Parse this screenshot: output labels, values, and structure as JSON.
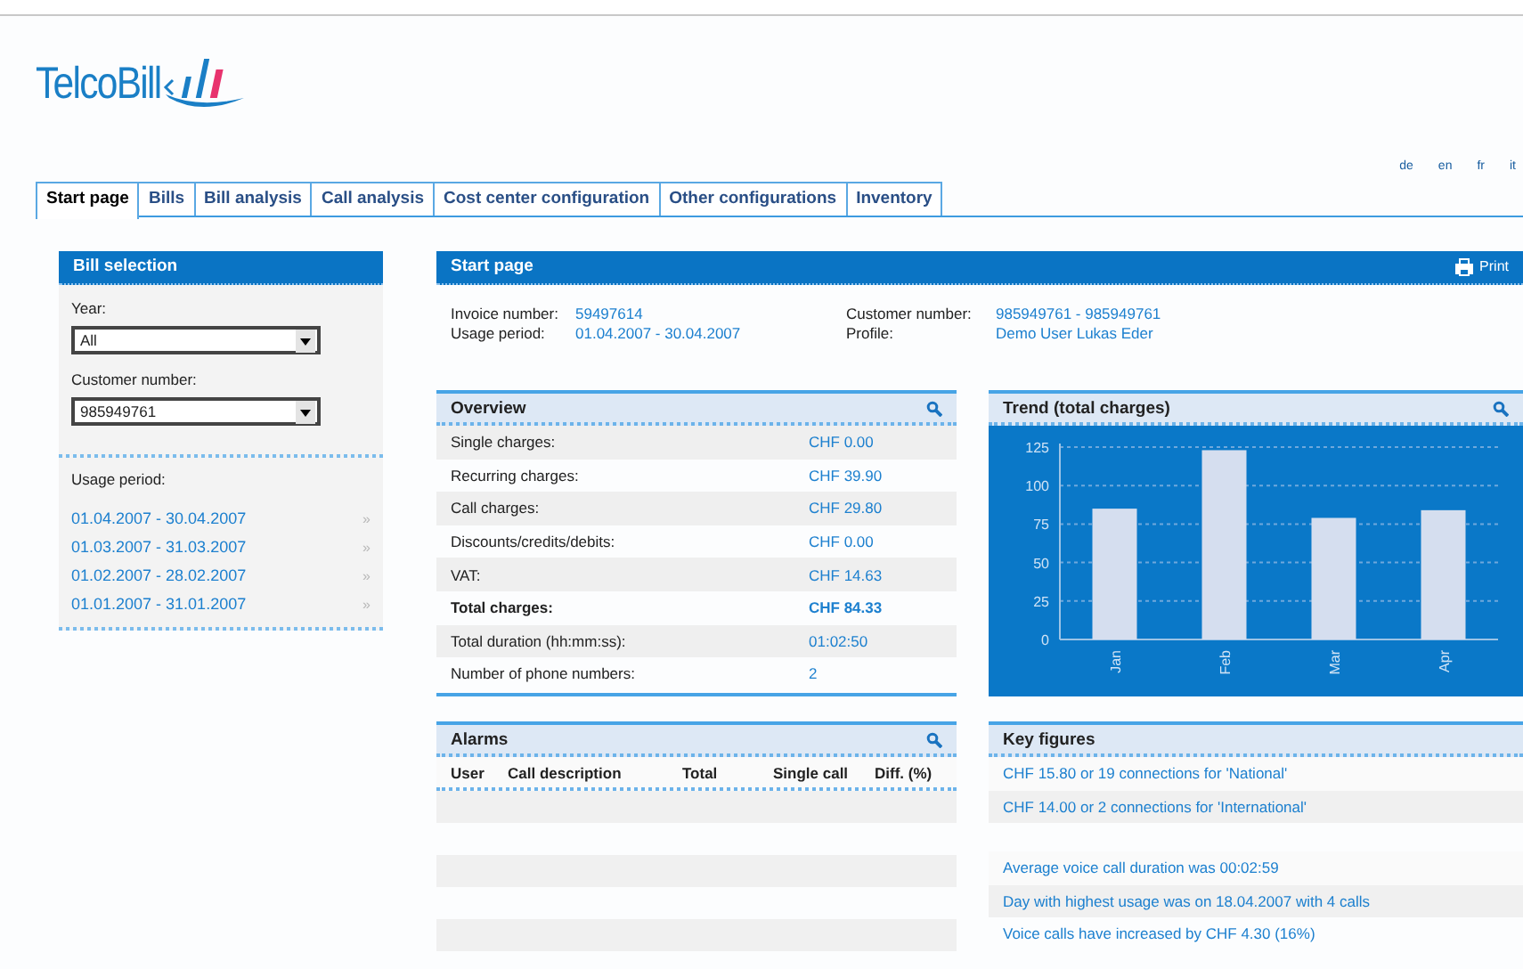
{
  "logo": {
    "text": "TelcoBill"
  },
  "languages": [
    {
      "label": "de"
    },
    {
      "label": "en"
    },
    {
      "label": "fr"
    },
    {
      "label": "it"
    }
  ],
  "tabs": [
    {
      "label": "Start page",
      "selected": true
    },
    {
      "label": "Bills",
      "selected": false
    },
    {
      "label": "Bill analysis",
      "selected": false
    },
    {
      "label": "Call analysis",
      "selected": false
    },
    {
      "label": "Cost center configuration",
      "selected": false
    },
    {
      "label": "Other configurations",
      "selected": false
    },
    {
      "label": "Inventory",
      "selected": false
    }
  ],
  "bill_selection": {
    "title": "Bill selection",
    "fields": [
      {
        "label": "Year:",
        "value": "All"
      },
      {
        "label": "Customer number:",
        "value": "985949761"
      }
    ],
    "usage_label": "Usage period:",
    "periods": [
      {
        "label": "01.04.2007 - 30.04.2007",
        "arrow": "»"
      },
      {
        "label": "01.03.2007 - 31.03.2007",
        "arrow": "»"
      },
      {
        "label": "01.02.2007 - 28.02.2007",
        "arrow": "»"
      },
      {
        "label": "01.01.2007 - 31.01.2007",
        "arrow": "»"
      }
    ]
  },
  "start_page": {
    "title": "Start page",
    "print": "Print",
    "info": [
      {
        "label": "Invoice number:",
        "value": "59497614"
      },
      {
        "label": "Customer number:",
        "value": "985949761 - 985949761"
      },
      {
        "label": "Usage period:",
        "value": "01.04.2007 - 30.04.2007"
      },
      {
        "label": "Profile:",
        "value": "Demo User Lukas Eder"
      }
    ]
  },
  "overview": {
    "title": "Overview",
    "rows": [
      {
        "label": "Single charges:",
        "value": "CHF 0.00",
        "kind": "item"
      },
      {
        "label": "Recurring charges:",
        "value": "CHF 39.90",
        "kind": "item"
      },
      {
        "label": "Call charges:",
        "value": "CHF 29.80",
        "kind": "item"
      },
      {
        "label": "Discounts/credits/debits:",
        "value": "CHF 0.00",
        "kind": "item"
      },
      {
        "label": "VAT:",
        "value": "CHF 14.63",
        "kind": "item"
      },
      {
        "label": "Total charges:",
        "value": "CHF 84.33",
        "kind": "total"
      },
      {
        "label": "Total duration (hh:mm:ss):",
        "value": "01:02:50",
        "kind": "item"
      },
      {
        "label": "Number of phone numbers:",
        "value": "2",
        "kind": "item"
      }
    ]
  },
  "trend": {
    "title": "Trend (total charges)",
    "chart_data": {
      "type": "bar",
      "categories": [
        "Jan",
        "Feb",
        "Mar",
        "Apr"
      ],
      "series": [
        {
          "color": "#d5deef",
          "values": [
            85,
            123,
            79,
            84
          ]
        }
      ],
      "grid": true,
      "ylim": [
        0,
        125
      ],
      "yticks": [
        0,
        25,
        50,
        75,
        100,
        125
      ]
    }
  },
  "alarms": {
    "title": "Alarms",
    "columns": [
      "User",
      "Call description",
      "Total",
      "Single call",
      "Diff. (%)"
    ]
  },
  "key_figures": {
    "title": "Key figures",
    "groups": [
      {
        "items": [
          "CHF 15.80 or 19 connections for 'National'",
          "CHF 14.00 or 2 connections for 'International'"
        ]
      },
      {
        "items": [
          "Average voice call duration was 00:02:59",
          "Day with highest usage was on 18.04.2007 with 4 calls",
          "Voice calls have increased by CHF 4.30 (16%)"
        ]
      }
    ]
  }
}
